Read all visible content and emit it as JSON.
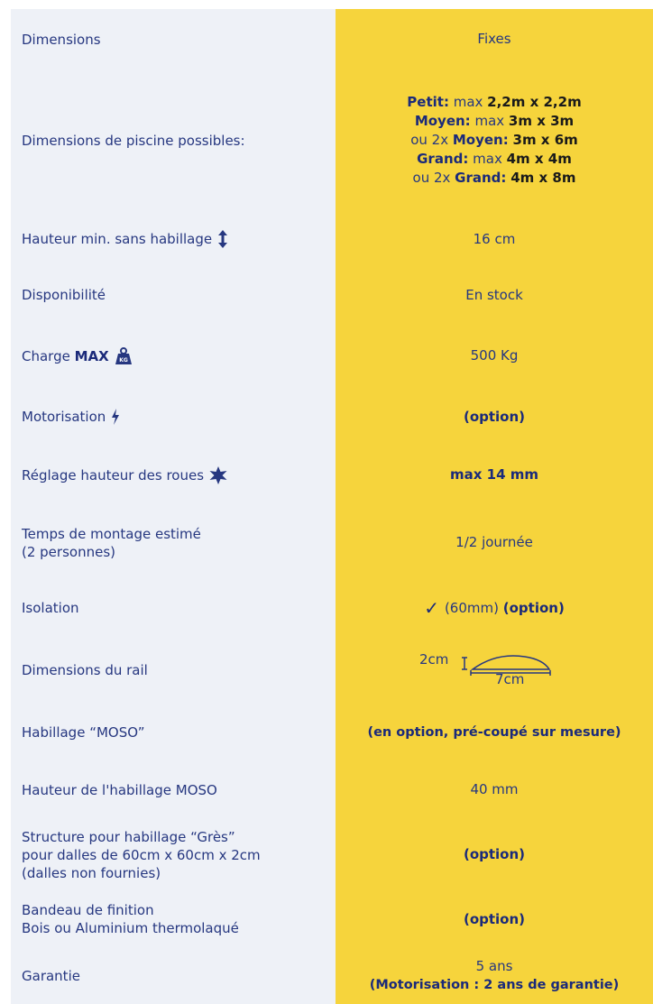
{
  "rows": {
    "dimensions": {
      "label": "Dimensions",
      "value": "Fixes"
    },
    "pool": {
      "label": "Dimensions de piscine possibles:",
      "lines": [
        {
          "pre": "",
          "b1": "Petit:",
          "mid": " max ",
          "b2": "2,2m x 2,2m"
        },
        {
          "pre": "",
          "b1": "Moyen:",
          "mid": " max ",
          "b2": "3m x 3m"
        },
        {
          "pre": "ou 2x ",
          "b1": "Moyen:",
          "mid": " ",
          "b2": "3m x 6m"
        },
        {
          "pre": "",
          "b1": "Grand:",
          "mid": " max ",
          "b2": "4m x 4m"
        },
        {
          "pre": "ou 2x ",
          "b1": "Grand:",
          "mid": " ",
          "b2": "4m x 8m"
        }
      ]
    },
    "height": {
      "label": "Hauteur min. sans habillage",
      "value": "16 cm"
    },
    "availability": {
      "label": "Disponibilité",
      "value": "En stock"
    },
    "load": {
      "label": "Charge",
      "label_bold": "MAX",
      "icon_text": "KG",
      "value": "500 Kg"
    },
    "motor": {
      "label": "Motorisation",
      "value": "(option)"
    },
    "wheels": {
      "label": "Réglage hauteur des roues",
      "value": "max 14 mm"
    },
    "mount": {
      "label_line1": "Temps de montage estimé",
      "label_line2": "(2 personnes)",
      "value": "1/2 journée"
    },
    "insulation": {
      "label": "Isolation",
      "check": "✓",
      "value": "(60mm)",
      "value_bold": "(option)"
    },
    "rail": {
      "label": "Dimensions du rail",
      "h": "2cm",
      "w": "7cm"
    },
    "moso": {
      "label": "Habillage “MOSO”",
      "value": "(en option, pré-coupé sur mesure)"
    },
    "moso_height": {
      "label": "Hauteur de l'habillage MOSO",
      "value": "40 mm"
    },
    "gres": {
      "label_line1": "Structure pour habillage “Grès”",
      "label_line2": "pour dalles de 60cm x 60cm x 2cm",
      "label_line3": "(dalles non fournies)",
      "value": "(option)"
    },
    "finish": {
      "label_line1": "Bandeau de finition",
      "label_line2": "Bois ou Aluminium thermolaqué",
      "value": "(option)"
    },
    "warranty": {
      "label": "Garantie",
      "value_line1": "5 ans",
      "value_line2": "(Motorisation : 2 ans de garantie)"
    }
  }
}
